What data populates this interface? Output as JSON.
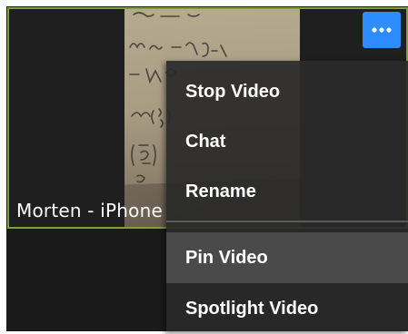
{
  "participant": {
    "name": "Morten - iPhone"
  },
  "more_button": {
    "icon": "more-horizontal-icon",
    "color": "#2d8cff"
  },
  "menu": {
    "items": [
      {
        "label": "Stop Video"
      },
      {
        "label": "Chat"
      },
      {
        "label": "Rename"
      },
      {
        "label": "Pin Video"
      },
      {
        "label": "Spotlight Video"
      }
    ],
    "hovered_item": "Pin Video"
  },
  "colors": {
    "active_speaker_border": "#7e9f3a",
    "menu_background": "#2a2a2a",
    "menu_hover": "#4a4a4a"
  }
}
